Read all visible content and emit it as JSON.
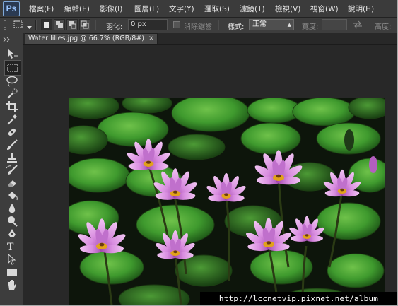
{
  "app": {
    "logo_text": "Ps"
  },
  "menu": [
    "檔案(F)",
    "編輯(E)",
    "影像(I)",
    "圖層(L)",
    "文字(Y)",
    "選取(S)",
    "濾鏡(T)",
    "檢視(V)",
    "視窗(W)",
    "說明(H)"
  ],
  "options_bar": {
    "tool_icon": "marquee-rectangle-icon",
    "feather_label": "羽化:",
    "feather_value": "0 px",
    "antialias_label": "消除鋸齒",
    "style_label": "樣式:",
    "style_value": "正常",
    "width_label": "寬度:",
    "height_label": "高度:"
  },
  "document": {
    "tab_title": "Water lilies.jpg @ 66.7% (RGB/8#)",
    "tab_close": "×",
    "image_subject": "water lilies"
  },
  "watermark": {
    "text": "http://lccnetvip.pixnet.net/album"
  },
  "colors": {
    "ui_dark": "#282828",
    "panel": "#3d3d3d",
    "ps_blue": "#9cc7ff",
    "lily_pink": "#d98ee0",
    "pad_green": "#3f9a2e"
  }
}
